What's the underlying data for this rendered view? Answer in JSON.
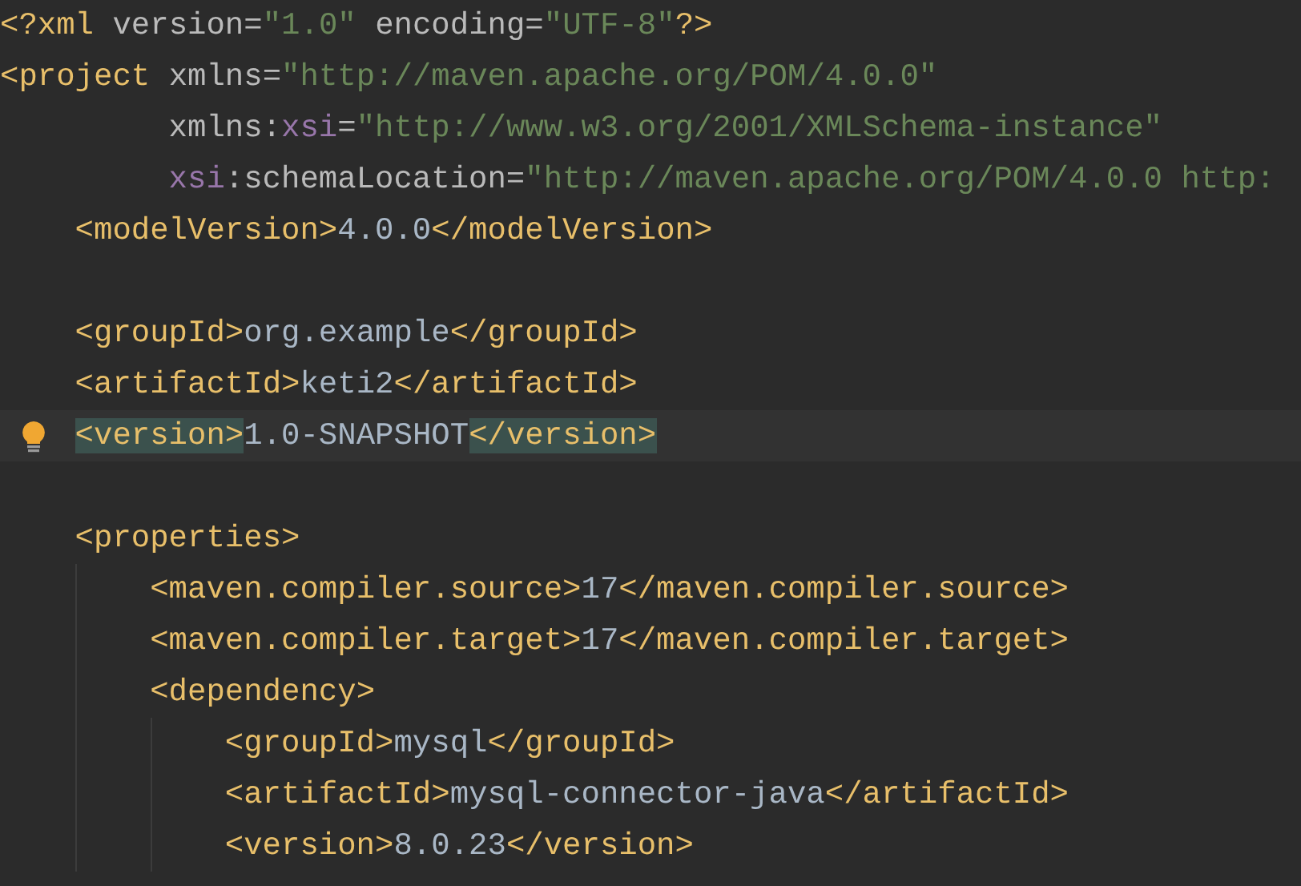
{
  "lines": [
    {
      "kind": "line",
      "tokens": [
        {
          "kind": "tag",
          "text": "<?xml "
        },
        {
          "kind": "attr",
          "text": "version="
        },
        {
          "kind": "value",
          "text": "\"1.0\" "
        },
        {
          "kind": "attr",
          "text": "encoding="
        },
        {
          "kind": "value",
          "text": "\"UTF-8\""
        },
        {
          "kind": "tag",
          "text": "?>"
        }
      ]
    },
    {
      "kind": "line",
      "tokens": [
        {
          "kind": "tag",
          "text": "<project "
        },
        {
          "kind": "attr",
          "text": "xmlns="
        },
        {
          "kind": "value",
          "text": "\"http://maven.apache.org/POM/4.0.0\""
        }
      ],
      "continuation": [
        {
          "tokens": [
            {
              "kind": "attr",
              "text": "xmlns:"
            },
            {
              "kind": "ns",
              "text": "xsi"
            },
            {
              "kind": "attr",
              "text": "="
            },
            {
              "kind": "value",
              "text": "\"http://www.w3.org/2001/XMLSchema-instance\""
            }
          ]
        },
        {
          "tokens": [
            {
              "kind": "ns",
              "text": "xsi"
            },
            {
              "kind": "attr",
              "text": ":schemaLocation="
            },
            {
              "kind": "value",
              "text": "\"http://maven.apache.org/POM/4.0.0 http:"
            }
          ]
        }
      ],
      "children": [
        {
          "kind": "line",
          "tokens": [
            {
              "kind": "tag",
              "text": "<modelVersion>"
            },
            {
              "kind": "text",
              "text": "4.0.0"
            },
            {
              "kind": "tag",
              "text": "</modelVersion>"
            }
          ]
        },
        {
          "kind": "blank"
        },
        {
          "kind": "line",
          "tokens": [
            {
              "kind": "tag",
              "text": "<groupId>"
            },
            {
              "kind": "text",
              "text": "org.example"
            },
            {
              "kind": "tag",
              "text": "</groupId>"
            }
          ]
        },
        {
          "kind": "line",
          "tokens": [
            {
              "kind": "tag",
              "text": "<artifactId>"
            },
            {
              "kind": "text",
              "text": "keti2"
            },
            {
              "kind": "tag",
              "text": "</artifactId>"
            }
          ]
        },
        {
          "kind": "line",
          "current": true,
          "bulb": true,
          "tokens": [
            {
              "kind": "tag",
              "text": "<version>",
              "matched": true
            },
            {
              "kind": "text",
              "text": "1.0-SNAPSHOT"
            },
            {
              "kind": "tag",
              "text": "</version>",
              "matched": true
            }
          ]
        },
        {
          "kind": "blank"
        },
        {
          "kind": "line",
          "tokens": [
            {
              "kind": "tag",
              "text": "<properties>"
            }
          ],
          "children": [
            {
              "kind": "line",
              "tokens": [
                {
                  "kind": "tag",
                  "text": "<maven.compiler.source>"
                },
                {
                  "kind": "text",
                  "text": "17"
                },
                {
                  "kind": "tag",
                  "text": "</maven.compiler.source>"
                }
              ]
            },
            {
              "kind": "line",
              "tokens": [
                {
                  "kind": "tag",
                  "text": "<maven.compiler.target>"
                },
                {
                  "kind": "text",
                  "text": "17"
                },
                {
                  "kind": "tag",
                  "text": "</maven.compiler.target>"
                }
              ]
            },
            {
              "kind": "line",
              "tokens": [
                {
                  "kind": "tag",
                  "text": "<dependency>"
                }
              ],
              "children": [
                {
                  "kind": "line",
                  "tokens": [
                    {
                      "kind": "tag",
                      "text": "<groupId>"
                    },
                    {
                      "kind": "text",
                      "text": "mysql"
                    },
                    {
                      "kind": "tag",
                      "text": "</groupId>"
                    }
                  ]
                },
                {
                  "kind": "line",
                  "tokens": [
                    {
                      "kind": "tag",
                      "text": "<artifactId>"
                    },
                    {
                      "kind": "text",
                      "text": "mysql-connector-java"
                    },
                    {
                      "kind": "tag",
                      "text": "</artifactId>"
                    }
                  ]
                },
                {
                  "kind": "line",
                  "tokens": [
                    {
                      "kind": "tag",
                      "text": "<version>"
                    },
                    {
                      "kind": "text",
                      "text": "8.0.23"
                    },
                    {
                      "kind": "tag",
                      "text": "</version>"
                    }
                  ]
                }
              ]
            }
          ]
        }
      ]
    }
  ]
}
